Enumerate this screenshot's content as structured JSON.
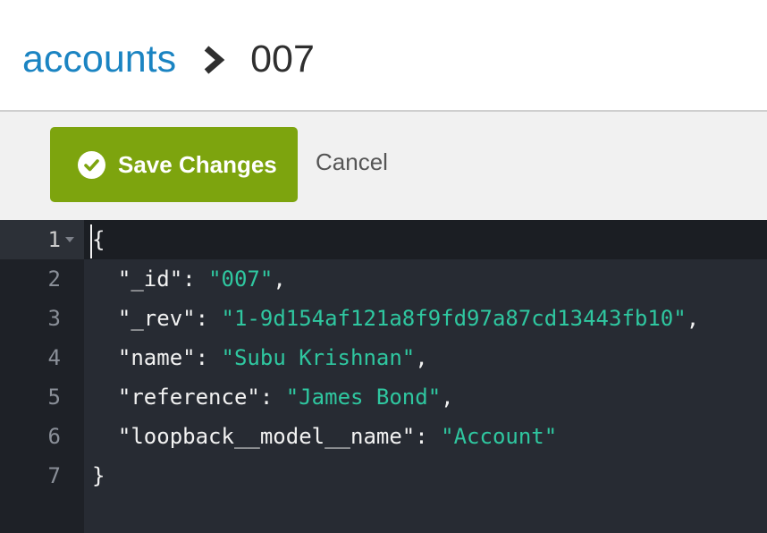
{
  "breadcrumb": {
    "parent": "accounts",
    "current": "007"
  },
  "toolbar": {
    "save_label": "Save Changes",
    "cancel_label": "Cancel"
  },
  "colors": {
    "accent_link": "#1b84c2",
    "save_button": "#7da40e",
    "editor_bg": "#272b33",
    "string": "#2fc7a0"
  },
  "editor": {
    "lines": [
      {
        "num": "1",
        "open": "{"
      },
      {
        "num": "2",
        "indent": "  ",
        "key": "\"_id\"",
        "sep": ": ",
        "value": "\"007\"",
        "end": ","
      },
      {
        "num": "3",
        "indent": "  ",
        "key": "\"_rev\"",
        "sep": ": ",
        "value": "\"1-9d154af121a8f9fd97a87cd13443fb10\"",
        "end": ","
      },
      {
        "num": "4",
        "indent": "  ",
        "key": "\"name\"",
        "sep": ": ",
        "value": "\"Subu Krishnan\"",
        "end": ","
      },
      {
        "num": "5",
        "indent": "  ",
        "key": "\"reference\"",
        "sep": ": ",
        "value": "\"James Bond\"",
        "end": ","
      },
      {
        "num": "6",
        "indent": "  ",
        "key": "\"loopback__model__name\"",
        "sep": ": ",
        "value": "\"Account\"",
        "end": ""
      },
      {
        "num": "7",
        "close": "}"
      }
    ]
  }
}
